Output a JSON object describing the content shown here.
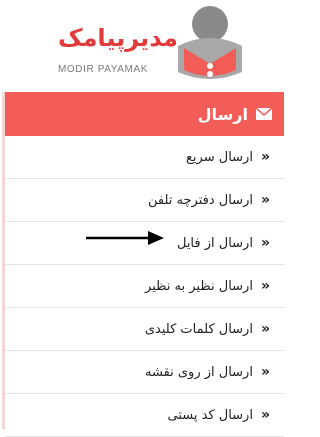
{
  "logo": {
    "brand_fa": "مدیرپیامک",
    "brand_en": "MODIR PAYAMAK"
  },
  "menu": {
    "header_label": "ارسال",
    "items": [
      {
        "label": "ارسال سریع"
      },
      {
        "label": "ارسال دفترچه تلفن"
      },
      {
        "label": "ارسال از فایل"
      },
      {
        "label": "ارسال نظیر به نظیر"
      },
      {
        "label": "ارسال کلمات کلیدی"
      },
      {
        "label": "ارسال از روی نقشه"
      },
      {
        "label": "ارسال کد پستی"
      }
    ]
  },
  "colors": {
    "accent": "#f25d58",
    "brand": "#e03a3a"
  },
  "icons": {
    "header": "envelope-icon",
    "item": "double-chevron-icon",
    "pointer": "arrow-right-icon"
  }
}
